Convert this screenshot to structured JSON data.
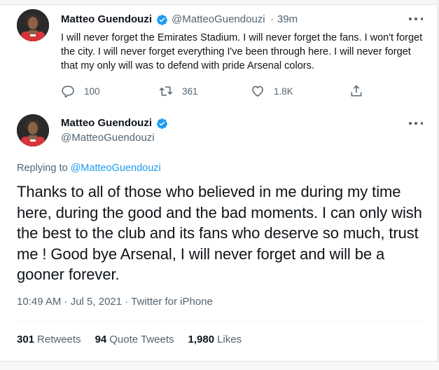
{
  "quoted_tweet": {
    "author_name": "Matteo Guendouzi",
    "handle": "@MatteoGuendouzi",
    "separator": "·",
    "time_ago": "39m",
    "text": "I will never forget the Emirates Stadium. I will never forget the fans. I won't forget the city. I will never forget everything I've been through here. I will never forget that my only will was to defend with pride Arsenal colors.",
    "actions": {
      "replies": "100",
      "retweets": "361",
      "likes": "1.8K"
    }
  },
  "main_tweet": {
    "author_name": "Matteo Guendouzi",
    "handle": "@MatteoGuendouzi",
    "replying_prefix": "Replying to",
    "replying_handle": "@MatteoGuendouzi",
    "text": "Thanks to all of those who believed in me during my time here, during the good and the bad moments. I can only wish the best to the club and its fans who deserve so much, trust me ! Good bye Arsenal, I will never forget and will be a gooner forever.",
    "timestamp": "10:49 AM · Jul 5, 2021 · Twitter for iPhone",
    "stats": {
      "retweets_count": "301",
      "retweets_label": "Retweets",
      "quotes_count": "94",
      "quotes_label": "Quote Tweets",
      "likes_count": "1,980",
      "likes_label": "Likes"
    }
  },
  "colors": {
    "verified": "#1d9bf0",
    "link": "#1d9bf0",
    "secondary_text": "#536471",
    "primary_text": "#0f1419"
  },
  "icons": {
    "reply": "reply-icon",
    "retweet": "retweet-icon",
    "like": "heart-icon",
    "share": "share-icon",
    "verified": "verified-badge-icon",
    "more": "more-options-icon"
  }
}
